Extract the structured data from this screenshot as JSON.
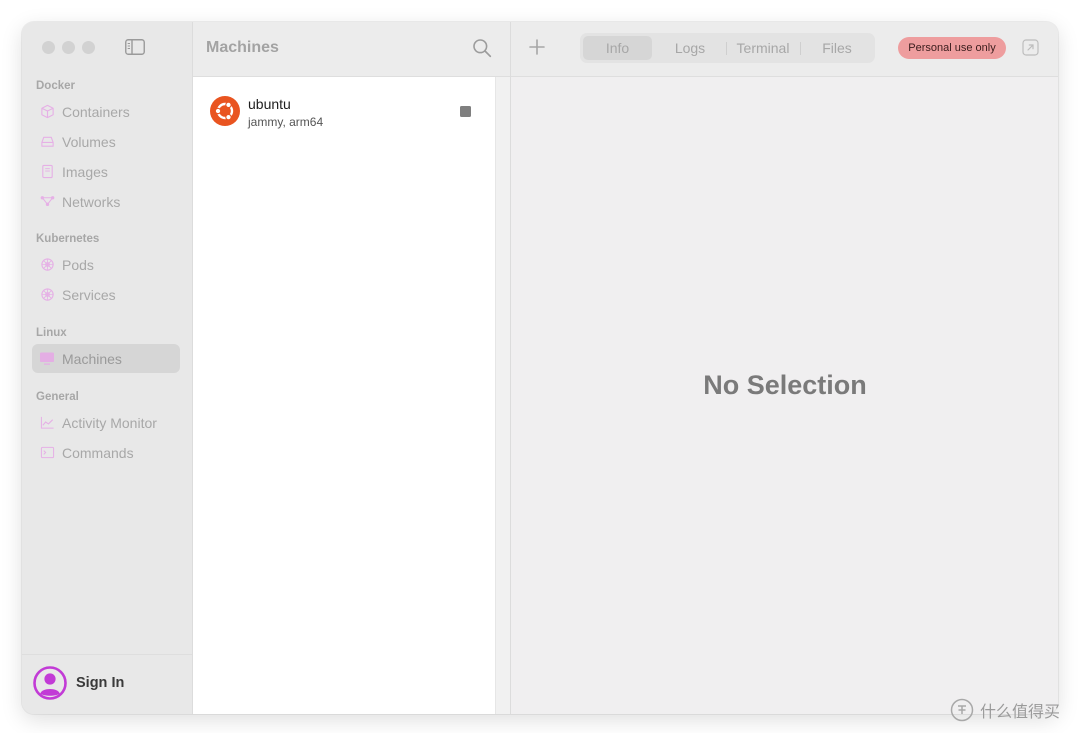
{
  "sidebar": {
    "sections": {
      "docker": "Docker",
      "kubernetes": "Kubernetes",
      "linux": "Linux",
      "general": "General"
    },
    "items": {
      "containers": {
        "label": "Containers",
        "icon": "cube-icon"
      },
      "volumes": {
        "label": "Volumes",
        "icon": "drive-icon"
      },
      "images": {
        "label": "Images",
        "icon": "document-icon"
      },
      "networks": {
        "label": "Networks",
        "icon": "network-icon"
      },
      "pods": {
        "label": "Pods",
        "icon": "helm-icon"
      },
      "services": {
        "label": "Services",
        "icon": "helm-icon"
      },
      "machines": {
        "label": "Machines",
        "icon": "monitor-icon",
        "selected": true
      },
      "activity_monitor": {
        "label": "Activity Monitor",
        "icon": "chart-icon"
      },
      "commands": {
        "label": "Commands",
        "icon": "terminal-icon"
      }
    },
    "sign_in": "Sign In"
  },
  "list": {
    "title": "Machines",
    "machines": [
      {
        "name": "ubuntu",
        "detail": "jammy, arm64",
        "icon": "ubuntu-logo-icon",
        "action_icon": "stop-icon"
      }
    ]
  },
  "detail": {
    "tabs": [
      "Info",
      "Logs",
      "Terminal",
      "Files"
    ],
    "selected_tab": "Info",
    "badge": "Personal use only",
    "empty_text": "No Selection"
  },
  "watermark": {
    "text": "什么值得买"
  },
  "colors": {
    "sidebar_bg": "#e8e8e8",
    "accent_pink": "#e8a8e8",
    "badge_bg": "#ee9d9e",
    "ubuntu_orange": "#e95420",
    "avatar_magenta": "#c23bd6"
  }
}
